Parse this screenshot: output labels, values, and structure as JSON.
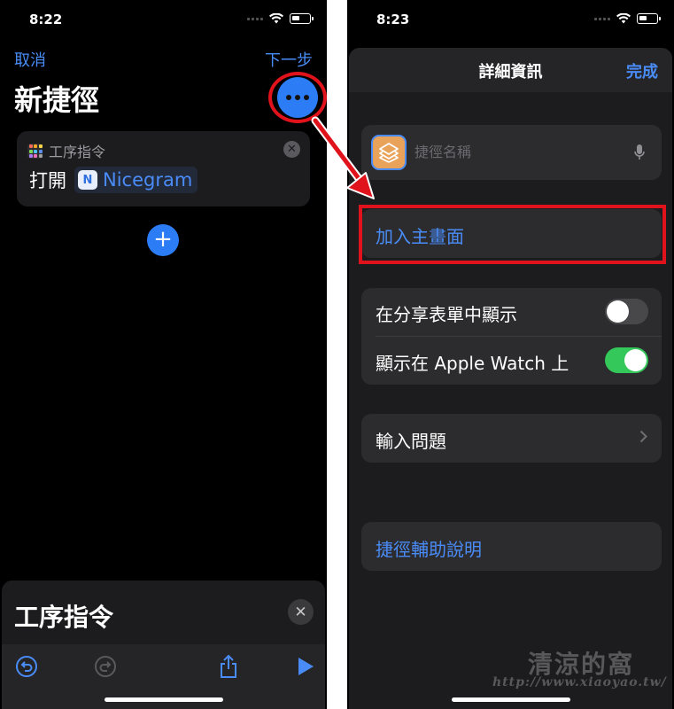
{
  "left_screen": {
    "status_time": "8:22",
    "nav": {
      "cancel": "取消",
      "next": "下一步"
    },
    "title": "新捷徑",
    "action_card": {
      "category": "工序指令",
      "verb": "打開",
      "app_name": "Nicegram"
    },
    "bottom_sheet": {
      "title": "工序指令"
    }
  },
  "right_screen": {
    "status_time": "8:23",
    "header": {
      "title": "詳細資訊",
      "done": "完成"
    },
    "name_field": {
      "placeholder": "捷徑名稱"
    },
    "add_to_home": "加入主畫面",
    "toggles": [
      {
        "label": "在分享表單中顯示",
        "on": false
      },
      {
        "label": "顯示在 Apple Watch 上",
        "on": true
      }
    ],
    "input_question": "輸入問題",
    "help": "捷徑輔助說明"
  },
  "colors": {
    "accent": "#4a8cf7",
    "annotation_red": "#e0121b",
    "toggle_on": "#34c759",
    "shortcut_icon": "#e9a25a"
  },
  "watermark": {
    "logo": "清涼的窩",
    "url": "http://www.xiaoyao.tw/"
  }
}
